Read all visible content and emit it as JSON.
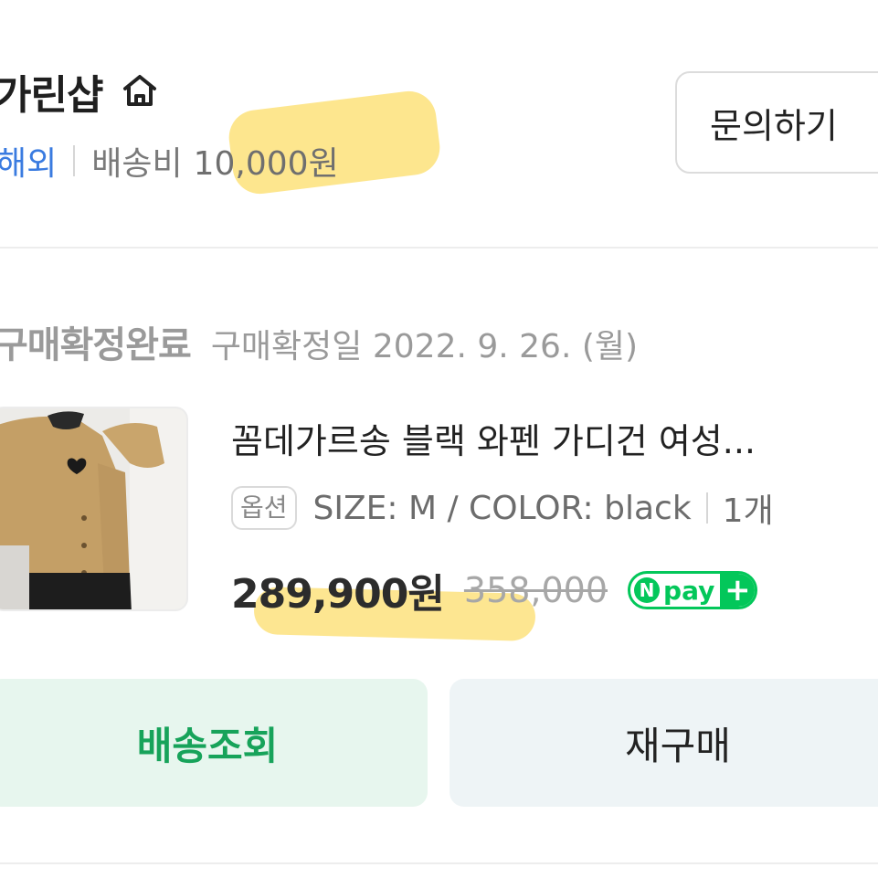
{
  "store": {
    "name": "가린샵",
    "overseas_label": "해외",
    "shipping_label": "배송비",
    "shipping_fee": "10,000원",
    "inquiry_button": "문의하기"
  },
  "order": {
    "status": "구매확정완료",
    "confirm_date": "구매확정일 2022. 9. 26. (월)"
  },
  "product": {
    "name": "꼼데가르송 블랙 와펜 가디건 여성...",
    "option_chip": "옵션",
    "option_text": "SIZE: M / COLOR: black",
    "quantity": "1개",
    "price": "289,900원",
    "original_price": "358,000",
    "npay_n": "N",
    "npay_text": "pay",
    "npay_plus": "+"
  },
  "actions": {
    "track_label": "배송조회",
    "rebuy_label": "재구매"
  },
  "colors": {
    "accent_green": "#17a35a",
    "link_blue": "#3a7be0",
    "highlight_yellow": "#fcd648"
  }
}
